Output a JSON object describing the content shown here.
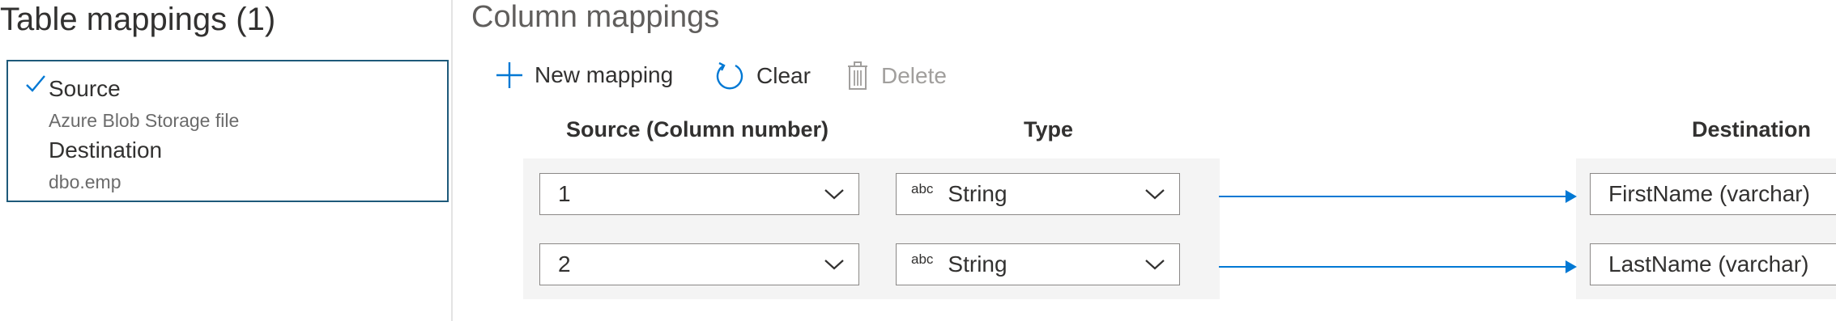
{
  "left": {
    "title": "Table mappings (1)",
    "mapping": {
      "source_label": "Source",
      "source_value": "Azure Blob Storage file",
      "destination_label": "Destination",
      "destination_value": "dbo.emp",
      "checked": true
    }
  },
  "right": {
    "title": "Column mappings",
    "toolbar": {
      "new_mapping": "New mapping",
      "clear": "Clear",
      "delete": "Delete"
    },
    "headers": {
      "source": "Source (Column number)",
      "type": "Type",
      "destination": "Destination"
    },
    "rows": [
      {
        "source": "1",
        "type_badge": "abc",
        "type": "String",
        "destination": "FirstName (varchar)"
      },
      {
        "source": "2",
        "type_badge": "abc",
        "type": "String",
        "destination": "LastName (varchar)"
      }
    ]
  },
  "colors": {
    "accent": "#0078d4",
    "card_border": "#1e5a7a",
    "disabled": "#a19f9d"
  }
}
